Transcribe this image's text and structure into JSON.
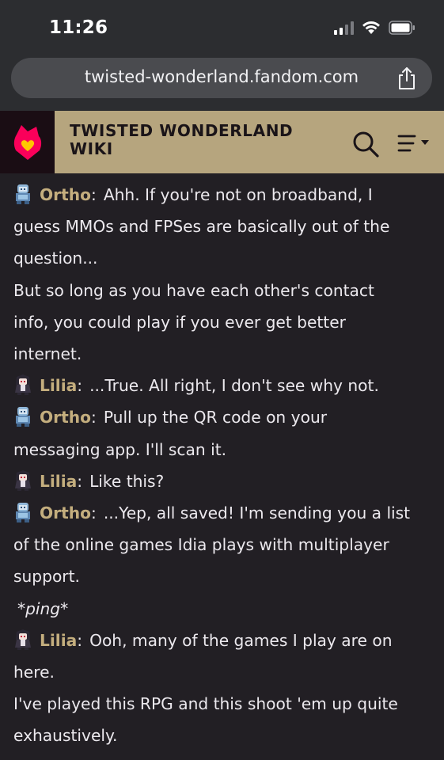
{
  "status_bar": {
    "time": "11:26"
  },
  "browser": {
    "url": "twisted-wonderland.fandom.com"
  },
  "wiki": {
    "title_line1": "TWISTED WONDERLAND",
    "title_line2": "WIKI",
    "accent_color": "#b6a57e",
    "logo_color": "#fa005a"
  },
  "transcript": {
    "speaker_color": "#c4ae7e",
    "entries": [
      {
        "speaker": "Ortho",
        "avatar": "ortho-chibi-icon",
        "lines": [
          "Ahh. If you're not on broadband, I",
          "guess MMOs and FPSes are basically out of the",
          "question...",
          "But so long as you have each other's contact",
          "info, you could play if you ever get better",
          "internet."
        ]
      },
      {
        "speaker": "Lilia",
        "avatar": "lilia-chibi-icon",
        "lines": [
          "...True. All right, I don't see why not."
        ]
      },
      {
        "speaker": "Ortho",
        "avatar": "ortho-chibi-icon",
        "lines": [
          "Pull up the QR code on your",
          "messaging app. I'll scan it."
        ]
      },
      {
        "speaker": "Lilia",
        "avatar": "lilia-chibi-icon",
        "lines": [
          "Like this?"
        ]
      },
      {
        "speaker": "Ortho",
        "avatar": "ortho-chibi-icon",
        "lines": [
          "...Yep, all saved! I'm sending you a list",
          "of the online games Idia plays with multiplayer",
          "support."
        ]
      },
      {
        "sfx": "*ping*"
      },
      {
        "speaker": "Lilia",
        "avatar": "lilia-chibi-icon",
        "lines": [
          "Ooh, many of the games I play are on",
          "here.",
          "I've played this RPG and this shoot 'em up quite",
          "exhaustively."
        ]
      }
    ]
  }
}
